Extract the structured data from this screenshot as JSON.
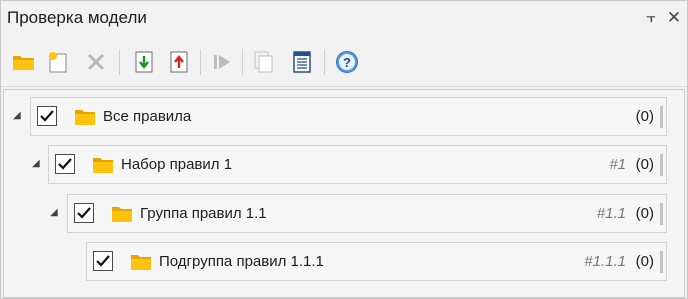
{
  "panel": {
    "title": "Проверка модели",
    "pin_glyph": "⫟",
    "close_glyph": "✕"
  },
  "toolbar": {
    "items": [
      {
        "icon": "open-folder-icon",
        "enabled": true
      },
      {
        "icon": "new-folder-icon",
        "enabled": true
      },
      {
        "icon": "delete-icon",
        "enabled": false
      },
      {
        "icon": "import-icon",
        "enabled": true
      },
      {
        "icon": "export-icon",
        "enabled": true
      },
      {
        "icon": "run-icon",
        "enabled": false
      },
      {
        "icon": "copy-report-icon",
        "enabled": false
      },
      {
        "icon": "report-icon",
        "enabled": true
      },
      {
        "icon": "help-icon",
        "enabled": true
      }
    ]
  },
  "tree": {
    "rows": [
      {
        "name": "Все правила",
        "number": "",
        "count": "(0)",
        "checked": true,
        "expanded": true
      },
      {
        "name": "Набор правил 1",
        "number": "#1",
        "count": "(0)",
        "checked": true,
        "expanded": true
      },
      {
        "name": "Группа правил 1.1",
        "number": "#1.1",
        "count": "(0)",
        "checked": true,
        "expanded": true
      },
      {
        "name": "Подгруппа правил 1.1.1",
        "number": "#1.1.1",
        "count": "(0)",
        "checked": true,
        "expanded": false
      }
    ]
  },
  "colors": {
    "folder_yellow": "#ffc20e",
    "folder_dark": "#e8a400",
    "import_green": "#1a8f2a",
    "export_red": "#d42020",
    "help_blue": "#2a72c4"
  }
}
